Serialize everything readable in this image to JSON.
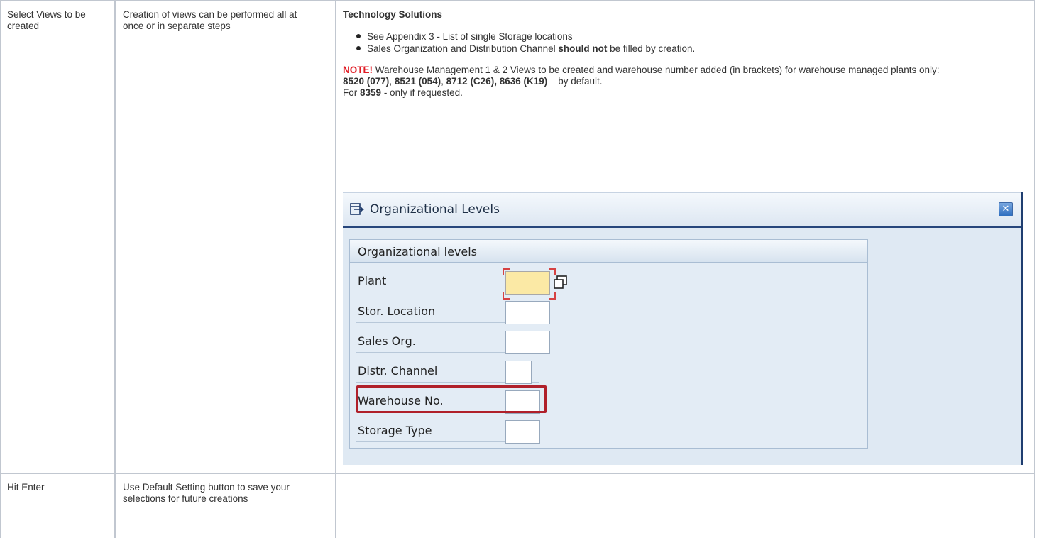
{
  "table": {
    "rows": [
      {
        "step": "Select Views to be created",
        "description": "Creation of views can be performed all at once or in separate steps",
        "details": {
          "heading": "Technology Solutions",
          "bullets": [
            {
              "text": "See Appendix 3 - List of single Storage locations"
            },
            {
              "text_before": "Sales Organization and Distribution Channel ",
              "bold": "should not",
              "text_after": " be filled by creation."
            }
          ],
          "note_label": "NOTE!",
          "note_text": " Warehouse Management 1 & 2 Views to be created and warehouse number added (in brackets) for warehouse managed plants only:",
          "plants_line": {
            "p1": "8520 (077)",
            "sep1": ", ",
            "p2": "8521 (054)",
            "sep2": ", ",
            "p3": "8712 (C26), 8636 (K19)",
            "suffix": " – by default."
          },
          "request_line": {
            "prefix": "For ",
            "plant": "8359",
            "suffix": " - only if requested."
          }
        }
      },
      {
        "step": "Hit Enter",
        "description": "Use Default Setting button to save your selections for future creations"
      }
    ]
  },
  "dialog": {
    "title": "Organizational Levels",
    "title_icon": "dialog-window-icon",
    "close_icon": "close-icon",
    "close_glyph": "✕",
    "group_title": "Organizational levels",
    "fields": [
      {
        "label": "Plant",
        "value": "",
        "required": true
      },
      {
        "label": "Stor. Location",
        "value": ""
      },
      {
        "label": "Sales Org.",
        "value": ""
      },
      {
        "label": "Distr. Channel",
        "value": ""
      },
      {
        "label": "Warehouse No.",
        "value": "",
        "highlighted": true
      },
      {
        "label": "Storage Type",
        "value": ""
      }
    ],
    "colors": {
      "highlight": "#b0202a",
      "required_field": "#fbe9a5",
      "note": "#e01b24"
    }
  }
}
